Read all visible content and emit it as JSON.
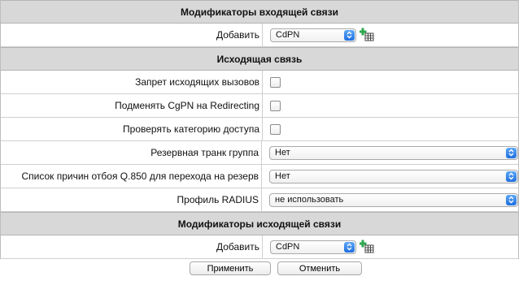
{
  "incoming_modifiers": {
    "header": "Модификаторы входящей связи",
    "add_label": "Добавить",
    "add_select_value": "CdPN",
    "add_icon": "add-table-icon"
  },
  "outgoing": {
    "header": "Исходящая связь",
    "rows": [
      {
        "label": "Запрет исходящих вызовов",
        "type": "checkbox",
        "checked": false
      },
      {
        "label": "Подменять CgPN на Redirecting",
        "type": "checkbox",
        "checked": false
      },
      {
        "label": "Проверять категорию доступа",
        "type": "checkbox",
        "checked": false
      },
      {
        "label": "Резервная транк группа",
        "type": "select",
        "value": "Нет"
      },
      {
        "label": "Список причин отбоя Q.850 для перехода на резерв",
        "type": "select",
        "value": "Нет"
      },
      {
        "label": "Профиль RADIUS",
        "type": "select",
        "value": "не использовать"
      }
    ]
  },
  "outgoing_modifiers": {
    "header": "Модификаторы исходящей связи",
    "add_label": "Добавить",
    "add_select_value": "CdPN",
    "add_icon": "add-table-icon"
  },
  "actions": {
    "apply_label": "Применить",
    "cancel_label": "Отменить"
  },
  "colors": {
    "section_bg": "#d8d8d8",
    "select_arrow": "#1f6fe0",
    "add_icon_plus": "#2fa84f"
  }
}
